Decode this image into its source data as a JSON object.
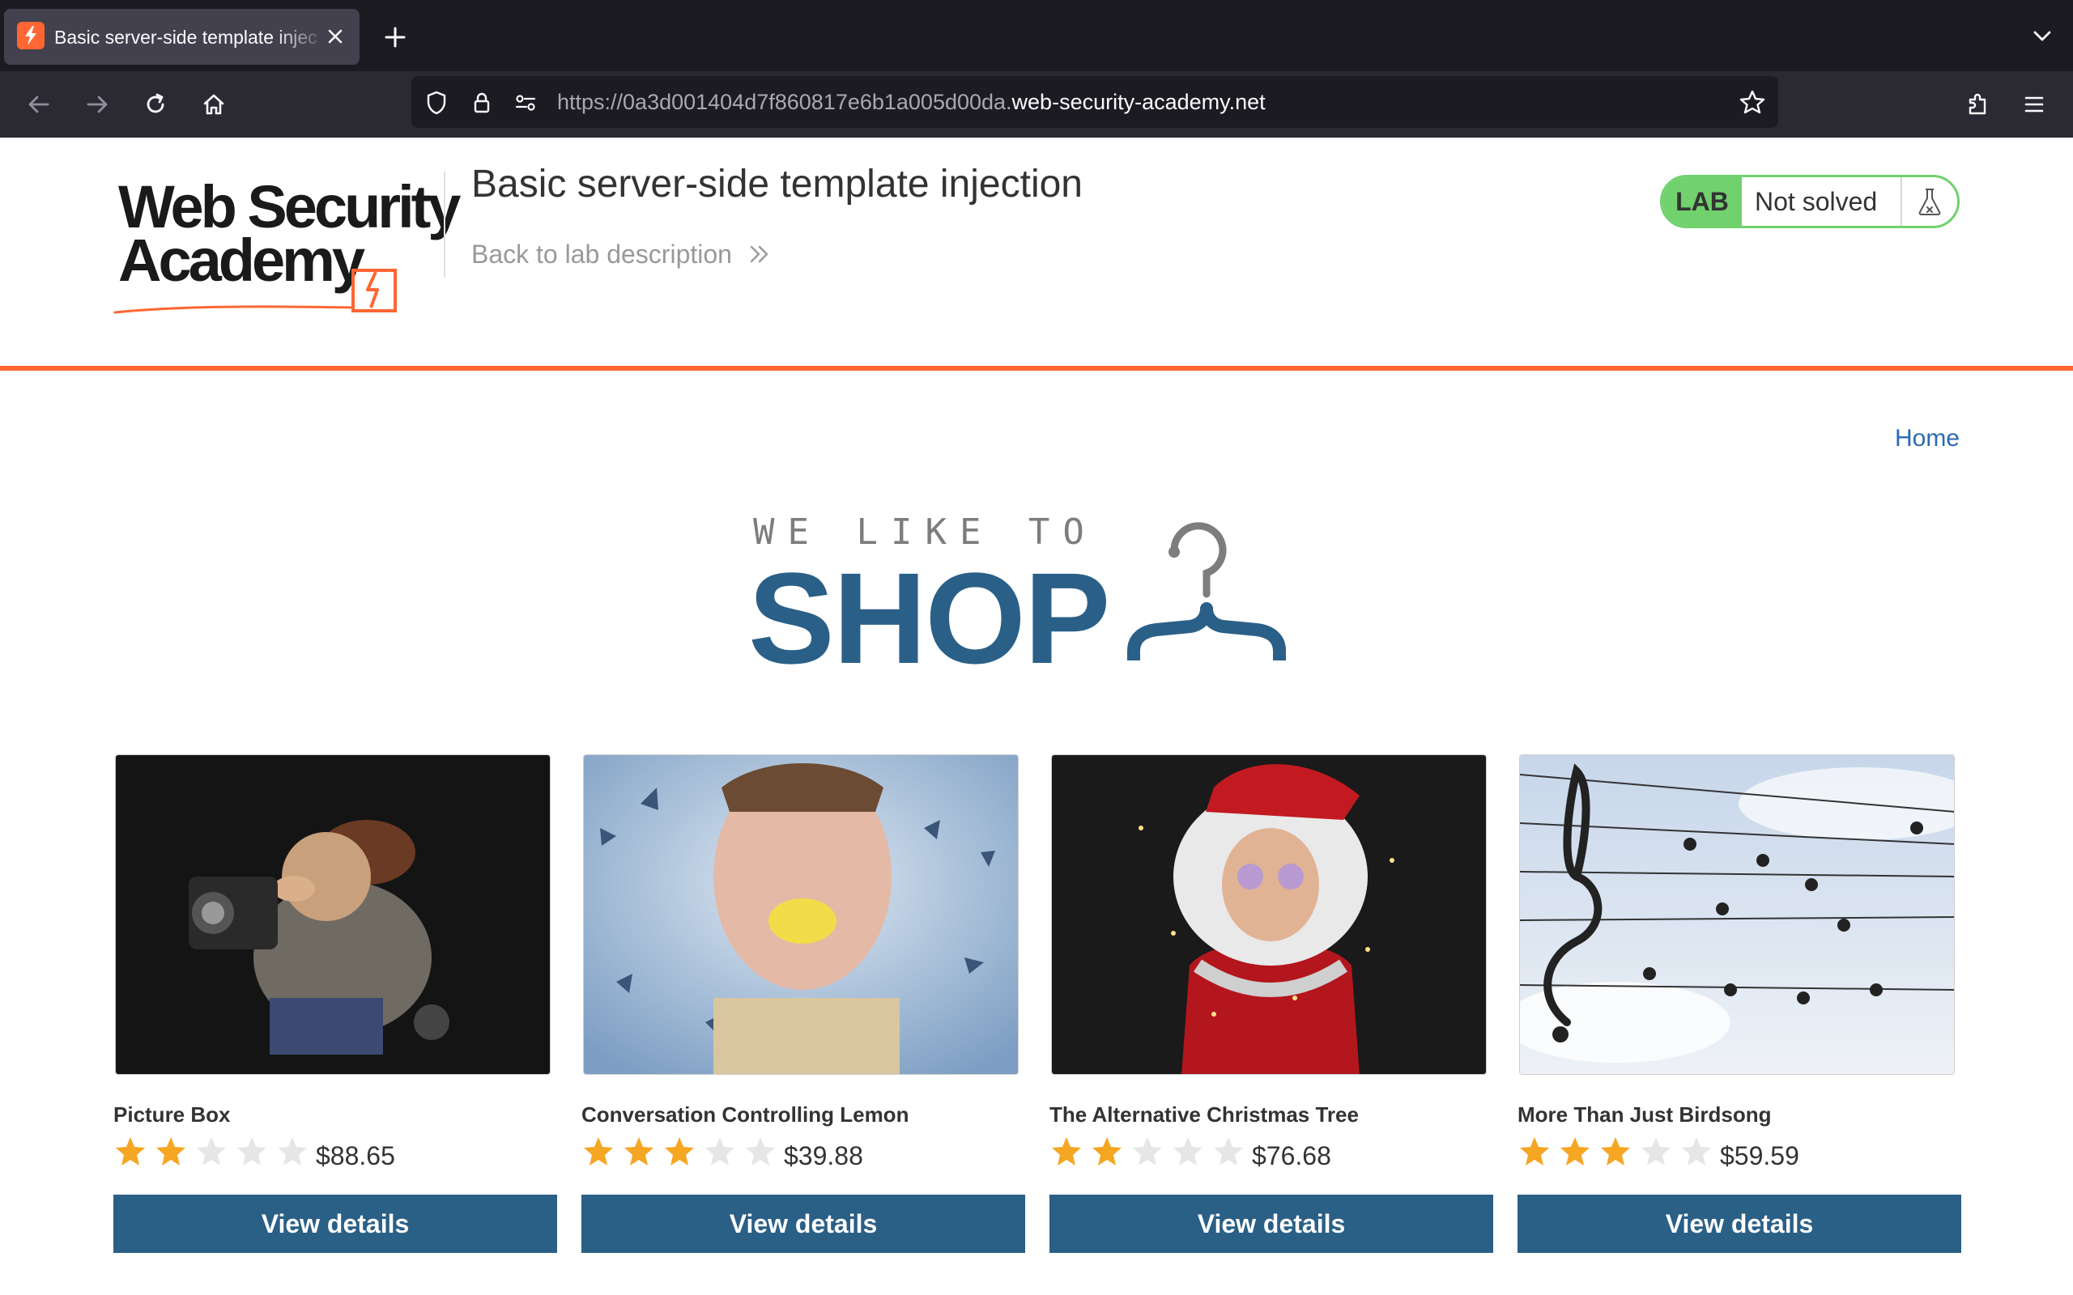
{
  "browser": {
    "tab_title": "Basic server-side template injec",
    "url_prefix": "https://0a3d001404d7f860817e6b1a005d00da.",
    "url_host": "web-security-academy.net"
  },
  "lab": {
    "logo_line1": "Web Security",
    "logo_line2": "Academy",
    "title": "Basic server-side template injection",
    "back_link": "Back to lab description",
    "badge_label": "LAB",
    "badge_status": "Not solved"
  },
  "nav": {
    "home": "Home"
  },
  "hero": {
    "tagline": "WE LIKE TO",
    "word": "SHOP"
  },
  "colors": {
    "accent": "#ff6633",
    "brand_blue": "#2a5f86",
    "badge_green": "#70d16d",
    "link": "#2a6ab2",
    "star": "#f5a623"
  },
  "products": [
    {
      "name": "Picture Box",
      "price": "$88.65",
      "rating": 2,
      "button": "View details"
    },
    {
      "name": "Conversation Controlling Lemon",
      "price": "$39.88",
      "rating": 3,
      "button": "View details"
    },
    {
      "name": "The Alternative Christmas Tree",
      "price": "$76.68",
      "rating": 2,
      "button": "View details"
    },
    {
      "name": "More Than Just Birdsong",
      "price": "$59.59",
      "rating": 3,
      "button": "View details"
    }
  ]
}
